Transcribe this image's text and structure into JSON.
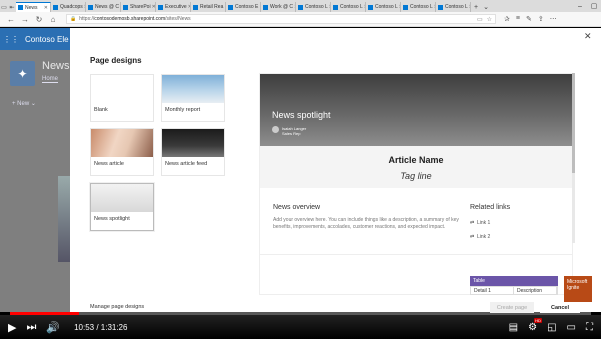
{
  "browser": {
    "tabs": [
      {
        "label": "News"
      },
      {
        "label": "Quadcops"
      },
      {
        "label": "News @ C"
      },
      {
        "label": "SharePoi"
      },
      {
        "label": "Executive"
      },
      {
        "label": "Retail Rea"
      },
      {
        "label": "Contoso E"
      },
      {
        "label": "Work @ C"
      },
      {
        "label": "Contoso L"
      },
      {
        "label": "Contoso L"
      },
      {
        "label": "Contoso L"
      },
      {
        "label": "Contoso L"
      },
      {
        "label": "Contoso L"
      }
    ],
    "url_prefix": "https://",
    "url_domain": "contosodemosb.sharepoint.com",
    "url_path": "/sites/News"
  },
  "sharepoint": {
    "site_name": "Contoso Ele",
    "page_title": "News",
    "home_link": "Home",
    "new_button": "New"
  },
  "panel": {
    "title": "Page designs",
    "designs": [
      {
        "label": "Blank"
      },
      {
        "label": "Monthly report"
      },
      {
        "label": "News article"
      },
      {
        "label": "News article feed"
      },
      {
        "label": "News spotlight"
      }
    ],
    "preview": {
      "hero_title": "News spotlight",
      "author_name": "Isaiah Langer",
      "author_role": "Sales Rep",
      "article_name": "Article Name",
      "tag_line": "Tag line",
      "overview_heading": "News overview",
      "overview_text": "Add your overview here. You can include things like a description, a summary of key benefits, improvements, accolades, customer reactions, and expected impact.",
      "related_heading": "Related links",
      "links": [
        "Link 1",
        "Link 2"
      ],
      "table_title": "Table",
      "table_cols": [
        "Detail 1",
        "Description"
      ]
    },
    "footer_link": "Manage page designs",
    "create_label": "Create page",
    "cancel_label": "Cancel",
    "badge_text": "Microsoft Ignite"
  },
  "video": {
    "time": "10:53 / 1:31:26",
    "progress": 0.119
  }
}
